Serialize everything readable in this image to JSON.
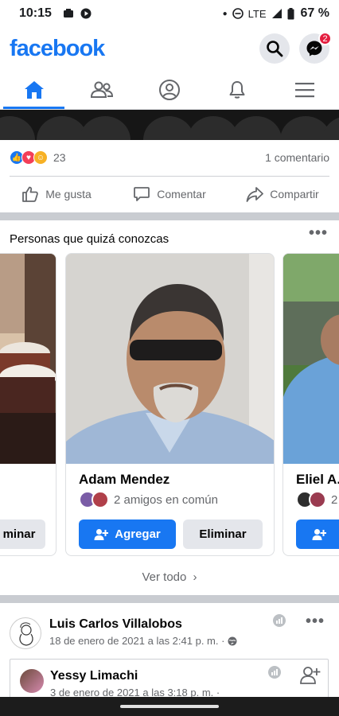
{
  "status": {
    "time": "10:15",
    "network": "LTE",
    "battery": "67 %"
  },
  "header": {
    "logo": "facebook",
    "messenger_badge": "2"
  },
  "tabs": [
    "home-icon",
    "friends-icon",
    "profile-icon",
    "notifications-icon",
    "menu-icon"
  ],
  "post": {
    "reaction_count": "23",
    "comment_count": "1 comentario",
    "actions": {
      "like": "Me gusta",
      "comment": "Comentar",
      "share": "Compartir"
    }
  },
  "pymk": {
    "title": "Personas que quizá conozcas",
    "cards": [
      {
        "name": "",
        "remove_label": "minar"
      },
      {
        "name": "Adam Mendez",
        "mutual": "2 amigos en común",
        "add_label": "Agregar",
        "remove_label": "Eliminar"
      },
      {
        "name": "Eliel A.",
        "mutual": "2"
      }
    ],
    "see_all": "Ver todo"
  },
  "feed_post": {
    "author": "Luis Carlos Villalobos",
    "timestamp": "18 de enero de 2021 a las 2:41 p. m. ·"
  },
  "shared_post": {
    "author": "Yessy Limachi",
    "timestamp": "3 de enero de 2021 a las 3:18 p. m. ·"
  },
  "colors": {
    "brand": "#1877f2",
    "badge": "#e41e3f",
    "secondary_text": "#65676b",
    "separator": "#c9ccd1"
  }
}
